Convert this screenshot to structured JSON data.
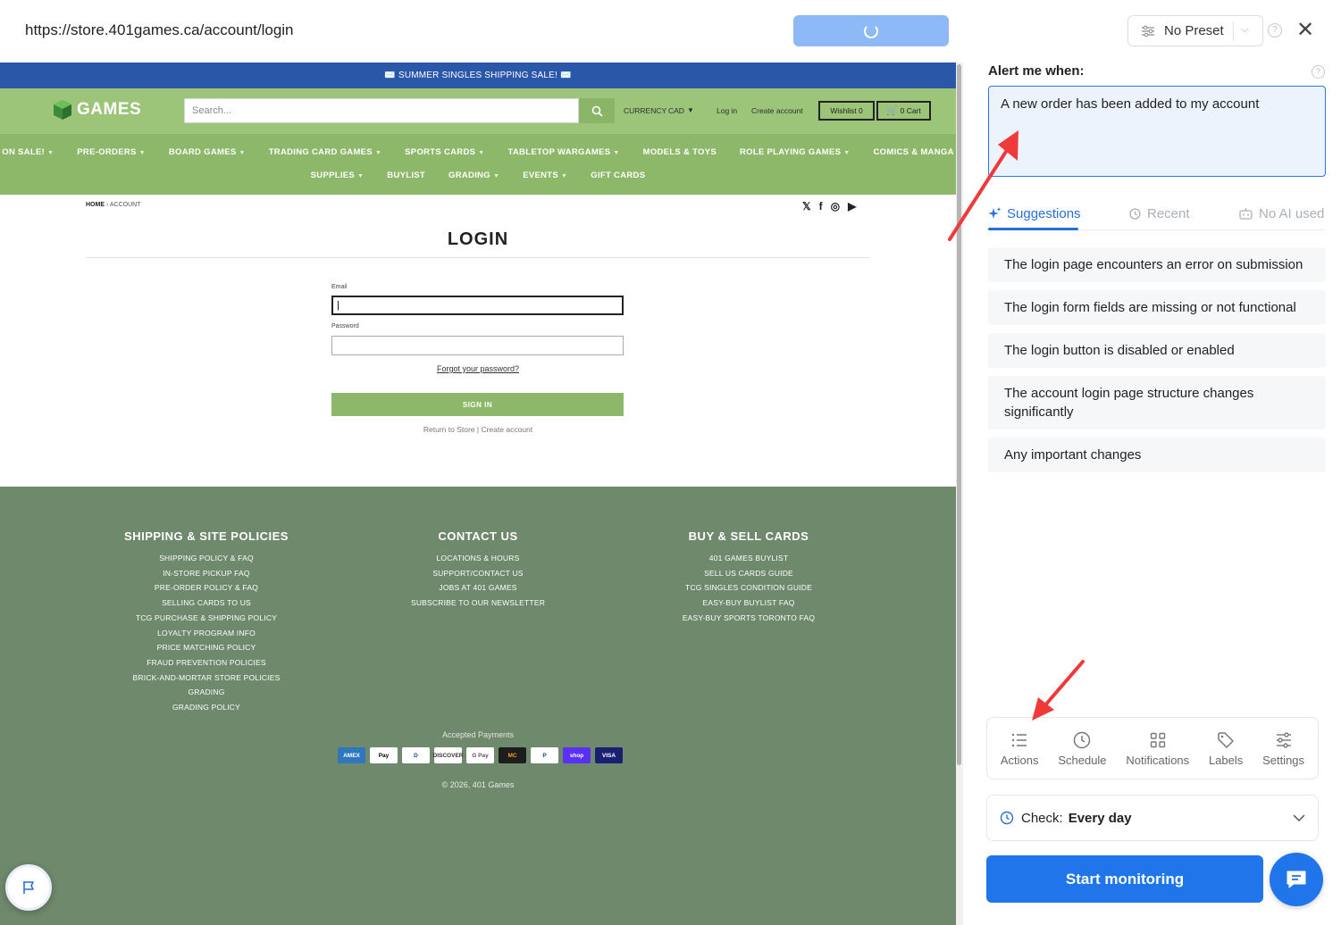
{
  "browser": {
    "url": "https://store.401games.ca/account/login"
  },
  "site": {
    "announcement": "✉️ SUMMER SINGLES SHIPPING SALE! ✉️",
    "logo_text": "GAMES",
    "search_placeholder": "Search...",
    "currency_label": "CURRENCY",
    "currency_value": "CAD",
    "login_link": "Log in",
    "create_account_link": "Create account",
    "wishlist": "Wishlist 0",
    "cart": "0 Cart",
    "nav_row1": [
      "ON SALE!",
      "PRE-ORDERS",
      "BOARD GAMES",
      "TRADING CARD GAMES",
      "SPORTS CARDS",
      "TABLETOP WARGAMES",
      "MODELS & TOYS",
      "ROLE PLAYING GAMES",
      "COMICS & MANGA"
    ],
    "nav_row2": [
      "SUPPLIES",
      "BUYLIST",
      "GRADING",
      "EVENTS",
      "GIFT CARDS"
    ],
    "breadcrumb_home": "HOME",
    "breadcrumb_sep": "›",
    "breadcrumb_current": "ACCOUNT",
    "social": [
      "twitter-icon",
      "facebook-icon",
      "instagram-icon",
      "youtube-icon"
    ],
    "login_title": "LOGIN",
    "email_label": "Email",
    "email_value": "|",
    "password_label": "Password",
    "forgot": "Forgot your password?",
    "sign_in": "SIGN IN",
    "return_links": "Return to Store | Create account",
    "footer": {
      "col1_title": "SHIPPING & SITE POLICIES",
      "col1_links": [
        "SHIPPING POLICY & FAQ",
        "IN-STORE PICKUP FAQ",
        "PRE-ORDER POLICY & FAQ",
        "SELLING CARDS TO US",
        "TCG PURCHASE & SHIPPING POLICY",
        "LOYALTY PROGRAM INFO",
        "PRICE MATCHING POLICY",
        "FRAUD PREVENTION POLICIES",
        "BRICK-AND-MORTAR STORE POLICIES",
        "GRADING",
        "GRADING POLICY"
      ],
      "col2_title": "CONTACT US",
      "col2_links": [
        "LOCATIONS & HOURS",
        "SUPPORT/CONTACT US",
        "JOBS AT 401 GAMES",
        "SUBSCRIBE TO OUR NEWSLETTER"
      ],
      "col3_title": "BUY & SELL CARDS",
      "col3_links": [
        "401 GAMES BUYLIST",
        "SELL US CARDS GUIDE",
        "TCG SINGLES CONDITION GUIDE",
        "EASY-BUY BUYLIST FAQ",
        "EASY-BUY SPORTS TORONTO FAQ"
      ],
      "accepted": "Accepted Payments",
      "payments": [
        "AMEX",
        "Pay",
        "D",
        "DISCOVER",
        "G Pay",
        "MC",
        "P",
        "shop",
        "VISA"
      ],
      "copyright": "© 2026, 401 Games"
    }
  },
  "panel": {
    "preset": "No Preset",
    "alert_label": "Alert me when:",
    "alert_text": "A new order has been added to my account",
    "tabs": [
      "Suggestions",
      "Recent",
      "No AI used"
    ],
    "suggestions": [
      "The login page encounters an error on submission",
      "The login form fields are missing or not functional",
      "The login button is disabled or enabled",
      "The account login page structure changes significantly",
      "Any important changes"
    ],
    "tools": [
      "Actions",
      "Schedule",
      "Notifications",
      "Labels",
      "Settings"
    ],
    "check_label": "Check:",
    "check_value": "Every day",
    "start_button": "Start monitoring"
  },
  "colors": {
    "accent_blue": "#2175ea",
    "site_green": "#9cc57a",
    "footer_green": "#6f896c",
    "announce_blue": "#2a57a8",
    "arrow_red": "#f03a3a"
  }
}
